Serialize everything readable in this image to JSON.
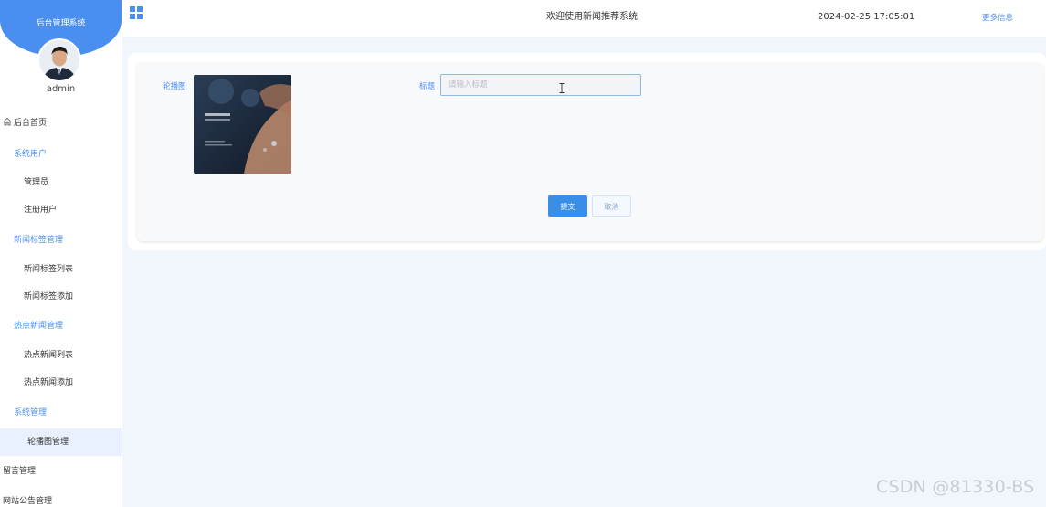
{
  "sidebar": {
    "system_name": "后台管理系统",
    "username": "admin",
    "items": [
      {
        "label": "后台首页",
        "kind": "top",
        "icon": "home-icon"
      },
      {
        "label": "系统用户",
        "kind": "group"
      },
      {
        "label": "管理员",
        "kind": "sub"
      },
      {
        "label": "注册用户",
        "kind": "sub"
      },
      {
        "label": "新闻标签管理",
        "kind": "group"
      },
      {
        "label": "新闻标签列表",
        "kind": "sub"
      },
      {
        "label": "新闻标签添加",
        "kind": "sub"
      },
      {
        "label": "热点新闻管理",
        "kind": "group"
      },
      {
        "label": "热点新闻列表",
        "kind": "sub"
      },
      {
        "label": "热点新闻添加",
        "kind": "sub"
      },
      {
        "label": "系统管理",
        "kind": "group"
      },
      {
        "label": "轮播图管理",
        "kind": "sub",
        "active": true
      },
      {
        "label": "留言管理",
        "kind": "top"
      },
      {
        "label": "网站公告管理",
        "kind": "top"
      }
    ]
  },
  "header": {
    "title": "欢迎使用新闻推荐系统",
    "datetime": "2024-02-25 17:05:01",
    "more": "更多信息",
    "menu_icon": "grid-icon"
  },
  "form": {
    "carousel_label": "轮播图",
    "title_label": "标题",
    "title_value": "",
    "title_placeholder": "请输入标题",
    "submit_label": "提交",
    "cancel_label": "取消"
  },
  "watermark": "CSDN @81330-BS",
  "colors": {
    "accent": "#4a8ff0",
    "sidebar_header": "#4a8ff0",
    "submit": "#3a8ee6",
    "page_bg": "#f0f6fc"
  }
}
